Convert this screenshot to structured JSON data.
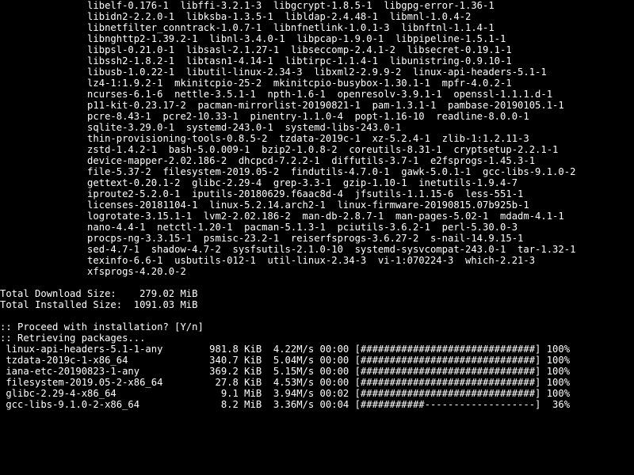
{
  "package_block_indent": "               ",
  "packages": [
    [
      "libelf-0.176-1",
      "libffi-3.2.1-3",
      "libgcrypt-1.8.5-1",
      "libgpg-error-1.36-1"
    ],
    [
      "libidn2-2.2.0-1",
      "libksba-1.3.5-1",
      "libldap-2.4.48-1",
      "libmnl-1.0.4-2"
    ],
    [
      "libnetfilter_conntrack-1.0.7-1",
      "libnfnetlink-1.0.1-3",
      "libnftnl-1.1.4-1"
    ],
    [
      "libnghttp2-1.39.2-1",
      "libnl-3.4.0-1",
      "libpcap-1.9.0-1",
      "libpipeline-1.5.1-1"
    ],
    [
      "libpsl-0.21.0-1",
      "libsasl-2.1.27-1",
      "libseccomp-2.4.1-2",
      "libsecret-0.19.1-1"
    ],
    [
      "libssh2-1.8.2-1",
      "libtasn1-4.14-1",
      "libtirpc-1.1.4-1",
      "libunistring-0.9.10-1"
    ],
    [
      "libusb-1.0.22-1",
      "libutil-linux-2.34-3",
      "libxml2-2.9.9-2",
      "linux-api-headers-5.1-1"
    ],
    [
      "lz4-1:1.9.2-1",
      "mkinitcpio-25-2",
      "mkinitcpio-busybox-1.30.1-1",
      "mpfr-4.0.2-1"
    ],
    [
      "ncurses-6.1-6",
      "nettle-3.5.1-1",
      "npth-1.6-1",
      "openresolv-3.9.1-1",
      "openssl-1.1.1.d-1"
    ],
    [
      "p11-kit-0.23.17-2",
      "pacman-mirrorlist-20190821-1",
      "pam-1.3.1-1",
      "pambase-20190105.1-1"
    ],
    [
      "pcre-8.43-1",
      "pcre2-10.33-1",
      "pinentry-1.1.0-4",
      "popt-1.16-10",
      "readline-8.0.0-1"
    ],
    [
      "sqlite-3.29.0-1",
      "systemd-243.0-1",
      "systemd-libs-243.0-1"
    ],
    [
      "thin-provisioning-tools-0.8.5-2",
      "tzdata-2019c-1",
      "xz-5.2.4-1",
      "zlib-1:1.2.11-3"
    ],
    [
      "zstd-1.4.2-1",
      "bash-5.0.009-1",
      "bzip2-1.0.8-2",
      "coreutils-8.31-1",
      "cryptsetup-2.2.1-1"
    ],
    [
      "device-mapper-2.02.186-2",
      "dhcpcd-7.2.2-1",
      "diffutils-3.7-1",
      "e2fsprogs-1.45.3-1"
    ],
    [
      "file-5.37-2",
      "filesystem-2019.05-2",
      "findutils-4.7.0-1",
      "gawk-5.0.1-1",
      "gcc-libs-9.1.0-2"
    ],
    [
      "gettext-0.20.1-2",
      "glibc-2.29-4",
      "grep-3.3-1",
      "gzip-1.10-1",
      "inetutils-1.9.4-7"
    ],
    [
      "iproute2-5.2.0-1",
      "iputils-20180629.f6aac8d-4",
      "jfsutils-1.1.15-6",
      "less-551-1"
    ],
    [
      "licenses-20181104-1",
      "linux-5.2.14.arch2-1",
      "linux-firmware-20190815.07b925b-1"
    ],
    [
      "logrotate-3.15.1-1",
      "lvm2-2.02.186-2",
      "man-db-2.8.7-1",
      "man-pages-5.02-1",
      "mdadm-4.1-1"
    ],
    [
      "nano-4.4-1",
      "netctl-1.20-1",
      "pacman-5.1.3-1",
      "pciutils-3.6.2-1",
      "perl-5.30.0-3"
    ],
    [
      "procps-ng-3.3.15-1",
      "psmisc-23.2-1",
      "reiserfsprogs-3.6.27-2",
      "s-nail-14.9.15-1"
    ],
    [
      "sed-4.7-1",
      "shadow-4.7-2",
      "sysfsutils-2.1.0-10",
      "systemd-sysvcompat-243.0-1",
      "tar-1.32-1"
    ],
    [
      "texinfo-6.6-1",
      "usbutils-012-1",
      "util-linux-2.34-3",
      "vi-1:070224-3",
      "which-2.21-3"
    ],
    [
      "xfsprogs-4.20.0-2"
    ]
  ],
  "totals": {
    "download_label": "Total Download Size:",
    "download_value": "  279.02 MiB",
    "installed_label": "Total Installed Size:",
    "installed_value": " 1091.03 MiB"
  },
  "prompt": ":: Proceed with installation? [Y/n]",
  "retrieving": ":: Retrieving packages...",
  "downloads": [
    {
      "name": " linux-api-headers-5.1-1-any",
      "size": "981.8 KiB",
      "speed": "4.22M/s",
      "eta": "00:00",
      "bar": "[##############################]",
      "pct": "100%"
    },
    {
      "name": " tzdata-2019c-1-x86_64",
      "size": "340.7 KiB",
      "speed": "5.04M/s",
      "eta": "00:00",
      "bar": "[##############################]",
      "pct": "100%"
    },
    {
      "name": " iana-etc-20190823-1-any",
      "size": "369.2 KiB",
      "speed": "5.15M/s",
      "eta": "00:00",
      "bar": "[##############################]",
      "pct": "100%"
    },
    {
      "name": " filesystem-2019.05-2-x86_64",
      "size": "27.8 KiB",
      "speed": "4.53M/s",
      "eta": "00:00",
      "bar": "[##############################]",
      "pct": "100%"
    },
    {
      "name": " glibc-2.29-4-x86_64",
      "size": "9.1 MiB",
      "speed": "3.94M/s",
      "eta": "00:02",
      "bar": "[##############################]",
      "pct": "100%"
    },
    {
      "name": " gcc-libs-9.1.0-2-x86_64",
      "size": "8.2 MiB",
      "speed": "3.36M/s",
      "eta": "00:04",
      "bar": "[###########-------------------]",
      "pct": " 36%"
    }
  ]
}
